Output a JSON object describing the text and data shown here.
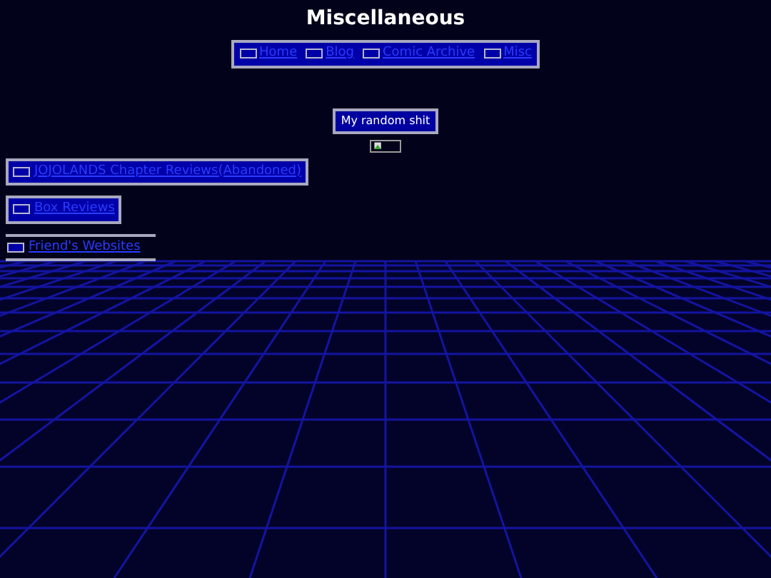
{
  "title": "Miscellaneous",
  "nav": [
    {
      "label": "Home"
    },
    {
      "label": "Blog"
    },
    {
      "label": "Comic Archive"
    },
    {
      "label": "Misc"
    }
  ],
  "center_button": {
    "label": "My random shit"
  },
  "center_image": {
    "kind": "broken-image"
  },
  "side_links": [
    {
      "label": "JOJOLANDS Chapter Reviews(Abandoned)",
      "kind": "panel"
    },
    {
      "label": "Box Reviews",
      "kind": "panel"
    },
    {
      "label": "Friend's Websites",
      "kind": "ruled"
    }
  ]
}
